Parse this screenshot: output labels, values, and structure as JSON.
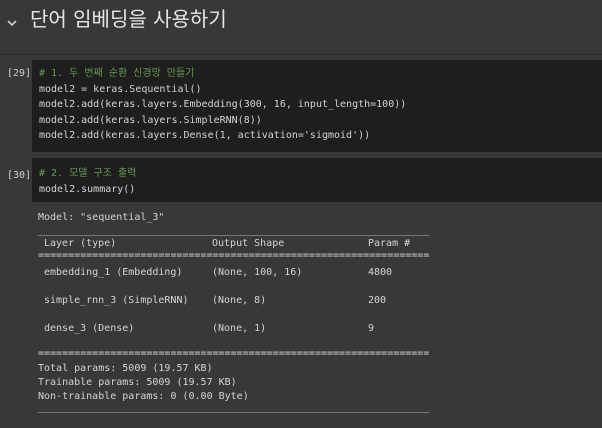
{
  "section": {
    "title": "단어 임베딩을 사용하기",
    "chevron_icon": "chevron-down-icon"
  },
  "cell29": {
    "execution_count": "[29]",
    "lines": [
      "# 1. 두 번째 순환 신경망 만들기",
      "model2 = keras.Sequential()",
      "model2.add(keras.layers.Embedding(300, 16, input_length=100))",
      "model2.add(keras.layers.SimpleRNN(8))",
      "model2.add(keras.layers.Dense(1, activation='sigmoid'))"
    ]
  },
  "cell30": {
    "execution_count": "[30]",
    "lines": [
      "# 2. 모델 구조 출력",
      "model2.summary()"
    ]
  },
  "summary": {
    "model_line": "Model: \"sequential_3\"",
    "headers": [
      "Layer (type)",
      "Output Shape",
      "Param #"
    ],
    "rows": [
      [
        "embedding_1 (Embedding)",
        "(None, 100, 16)",
        "4800"
      ],
      [
        "simple_rnn_3 (SimpleRNN)",
        "(None, 8)",
        "200"
      ],
      [
        "dense_3 (Dense)",
        "(None, 1)",
        "9"
      ]
    ],
    "total_params": "Total params: 5009 (19.57 KB)",
    "trainable_params": "Trainable params: 5009 (19.57 KB)",
    "non_trainable_params": "Non-trainable params: 0 (0.00 Byte)",
    "dash_rule": "_________________________________________________________________",
    "eq_rule": "================================================================="
  }
}
